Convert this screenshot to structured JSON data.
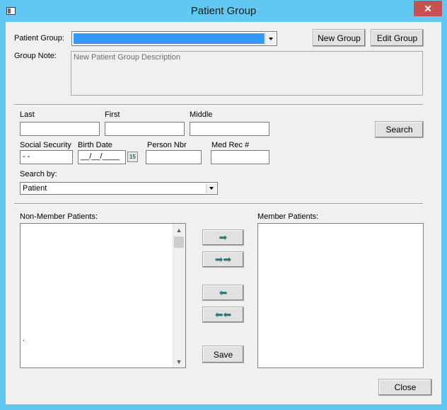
{
  "window": {
    "title": "Patient Group",
    "close_glyph": "✕"
  },
  "group": {
    "label": "Patient Group:",
    "selected": "",
    "new_button": "New Group",
    "edit_button": "Edit Group",
    "note_label": "Group Note:",
    "note_placeholder": "New Patient Group Description"
  },
  "search": {
    "last_label": "Last",
    "first_label": "First",
    "middle_label": "Middle",
    "search_button": "Search",
    "ssn_label": "Social Security",
    "ssn_value": " -  -",
    "birth_label": "Birth Date",
    "birth_value": "__/__/____",
    "calendar_glyph": "15",
    "person_label": "Person Nbr",
    "medrec_label": "Med Rec #",
    "search_by_label": "Search by:",
    "search_by_value": "Patient"
  },
  "lists": {
    "nonmember_label": "Non-Member Patients:",
    "nonmember_items": [
      "."
    ],
    "member_label": "Member Patients:",
    "scroll_up": "▲",
    "scroll_down": "▼"
  },
  "actions": {
    "add_one": "➡",
    "add_all": "➡➡",
    "remove_one": "⬅",
    "remove_all": "⬅⬅",
    "save": "Save",
    "close": "Close"
  },
  "colors": {
    "window_frame": "#60c8f2",
    "selection": "#3399ff",
    "arrow": "#2e7a7a",
    "close_hover": "#c75050"
  }
}
